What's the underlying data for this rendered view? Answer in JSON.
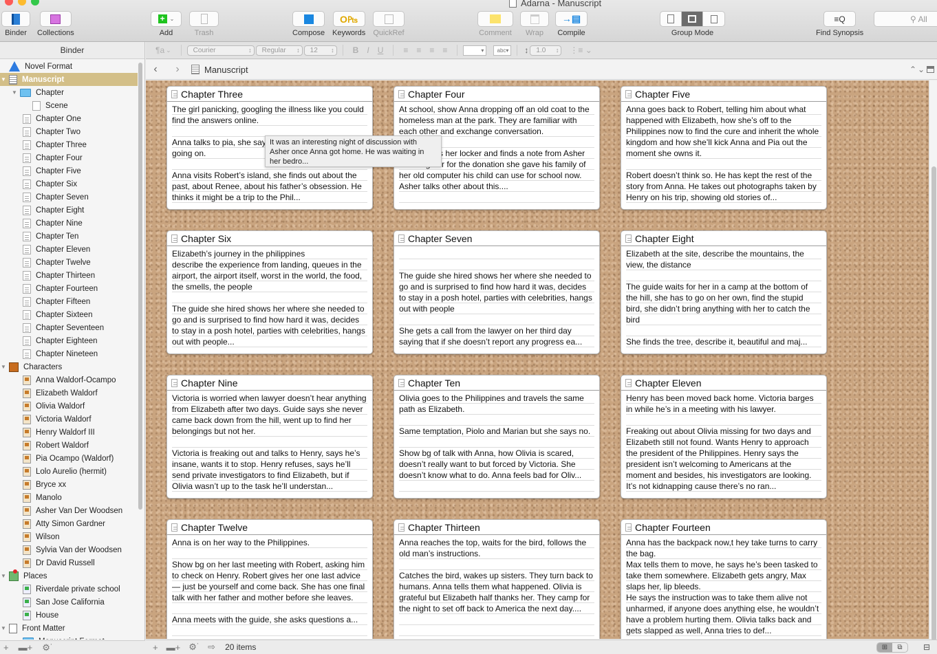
{
  "window": {
    "title": "Adarna - Manuscript",
    "traffic_colors": [
      "#fc5b57",
      "#fdbb2e",
      "#34c84a"
    ]
  },
  "toolbar": {
    "binder": "Binder",
    "collections": "Collections",
    "add": "Add",
    "trash": "Trash",
    "compose": "Compose",
    "keywords": "Keywords",
    "quickref": "QuickRef",
    "comment": "Comment",
    "wrap": "Wrap",
    "compile": "Compile",
    "group_mode": "Group Mode",
    "find_synopsis": "Find Synopsis",
    "search_placeholder": "All"
  },
  "format_bar": {
    "paragraph_style": "¶a",
    "font": "Courier",
    "weight": "Regular",
    "size": "12",
    "bold": "B",
    "italic": "I",
    "underline": "U",
    "highlight": "abc",
    "line_spacing": "1.0"
  },
  "binder": {
    "header": "Binder",
    "items": [
      {
        "label": "Novel Format",
        "icon": "warning-icon",
        "level": 0,
        "disclosure": ""
      },
      {
        "label": "Manuscript",
        "icon": "manuscript-icon",
        "level": 0,
        "disclosure": "open",
        "selected": true
      },
      {
        "label": "Chapter",
        "icon": "folder-icon",
        "level": 1,
        "disclosure": "open"
      },
      {
        "label": "Scene",
        "icon": "blank-doc-icon",
        "level": 2,
        "disclosure": ""
      },
      {
        "label": "Chapter One",
        "icon": "document-icon",
        "level": 1
      },
      {
        "label": "Chapter Two",
        "icon": "document-icon",
        "level": 1
      },
      {
        "label": "Chapter Three",
        "icon": "document-icon",
        "level": 1
      },
      {
        "label": "Chapter Four",
        "icon": "document-icon",
        "level": 1
      },
      {
        "label": "Chapter Five",
        "icon": "document-icon",
        "level": 1
      },
      {
        "label": "Chapter Six",
        "icon": "document-icon",
        "level": 1
      },
      {
        "label": "Chapter Seven",
        "icon": "document-icon",
        "level": 1
      },
      {
        "label": "Chapter Eight",
        "icon": "document-icon",
        "level": 1
      },
      {
        "label": "Chapter Nine",
        "icon": "document-icon",
        "level": 1
      },
      {
        "label": "Chapter Ten",
        "icon": "document-icon",
        "level": 1
      },
      {
        "label": "Chapter Eleven",
        "icon": "document-icon",
        "level": 1
      },
      {
        "label": "Chapter Twelve",
        "icon": "document-icon",
        "level": 1
      },
      {
        "label": "Chapter Thirteen",
        "icon": "document-icon",
        "level": 1
      },
      {
        "label": "Chapter Fourteen",
        "icon": "document-icon",
        "level": 1
      },
      {
        "label": "Chapter Fifteen",
        "icon": "document-icon",
        "level": 1
      },
      {
        "label": "Chapter Sixteen",
        "icon": "document-icon",
        "level": 1
      },
      {
        "label": "Chapter Seventeen",
        "icon": "document-icon",
        "level": 1
      },
      {
        "label": "Chapter Eighteen",
        "icon": "document-icon",
        "level": 1
      },
      {
        "label": "Chapter Nineteen",
        "icon": "document-icon",
        "level": 1
      },
      {
        "label": "Characters",
        "icon": "characters-folder-icon",
        "level": 0,
        "disclosure": "open"
      },
      {
        "label": "Anna Waldorf-Ocampo",
        "icon": "character-sheet-icon",
        "level": 1
      },
      {
        "label": "Elizabeth Waldorf",
        "icon": "character-sheet-icon",
        "level": 1
      },
      {
        "label": "Olivia Waldorf",
        "icon": "character-sheet-icon",
        "level": 1
      },
      {
        "label": "Victoria Waldorf",
        "icon": "character-sheet-icon",
        "level": 1
      },
      {
        "label": "Henry Waldorf III",
        "icon": "character-sheet-icon",
        "level": 1
      },
      {
        "label": "Robert Waldorf",
        "icon": "character-sheet-icon",
        "level": 1
      },
      {
        "label": "Pia Ocampo (Waldorf)",
        "icon": "character-sheet-icon",
        "level": 1
      },
      {
        "label": "Lolo Aurelio (hermit)",
        "icon": "character-sheet-icon",
        "level": 1
      },
      {
        "label": "Bryce xx",
        "icon": "character-sheet-icon",
        "level": 1
      },
      {
        "label": "Manolo",
        "icon": "character-sheet-icon",
        "level": 1
      },
      {
        "label": "Asher Van Der Woodsen",
        "icon": "character-sheet-icon",
        "level": 1
      },
      {
        "label": "Atty Simon Gardner",
        "icon": "character-sheet-icon",
        "level": 1
      },
      {
        "label": "Wilson",
        "icon": "character-sheet-icon",
        "level": 1
      },
      {
        "label": "Sylvia Van der Woodsen",
        "icon": "character-sheet-icon",
        "level": 1
      },
      {
        "label": "Dr David Russell",
        "icon": "character-sheet-icon",
        "level": 1
      },
      {
        "label": "Places",
        "icon": "places-folder-icon",
        "level": 0,
        "disclosure": "open"
      },
      {
        "label": "Riverdale private school",
        "icon": "place-sheet-icon",
        "level": 1
      },
      {
        "label": "San Jose California",
        "icon": "place-sheet-icon",
        "level": 1
      },
      {
        "label": "House",
        "icon": "place-sheet-icon",
        "level": 1
      },
      {
        "label": "Front Matter",
        "icon": "front-matter-icon",
        "level": 0,
        "disclosure": "open"
      },
      {
        "label": "Manuscript Format",
        "icon": "folder-icon",
        "level": 1,
        "disclosure": "closed"
      }
    ]
  },
  "editor": {
    "breadcrumb": "Manuscript",
    "item_count": "20 items",
    "tooltip": "It was an interesting night of discussion with Asher once Anna got home. He was waiting in her bedro...",
    "cards": [
      {
        "title": "Chapter Three",
        "synopsis": "The girl panicking, googling the illness like you could find the answers online.\n\nAnna talks to pia, she says she might know what’s going on.\n\nAnna visits Robert’s island, she finds out about the past, about Renee, about his father’s obsession. He thinks it might be a trip to the Phil..."
      },
      {
        "title": "Chapter Four",
        "synopsis": "At school, show Anna dropping off an old coat to the homeless man at the park. They are familiar with each other and exchange conversation.\n\nAnna opens her locker and finds a note from Asher thanking her for the donation she gave his family of her old computer his child can use for school now. Asher talks other about this...."
      },
      {
        "title": "Chapter Five",
        "synopsis": "Anna goes back to Robert, telling him about what happened with Elizabeth, how she’s off to the Philippines now to find the cure and inherit the whole kingdom and how she’ll kick Anna and Pia out the moment she owns it.\n\nRobert doesn’t think so. He has kept the rest of the story from Anna. He takes out photographs taken by Henry on his trip, showing old stories of..."
      },
      {
        "title": "Chapter Six",
        "synopsis": "Elizabeth’s journey in the philippines\ndescribe the experience from landing, queues in the airport, the airport itself, worst in the world, the food, the smells, the people\n\nThe guide she hired shows her where she needed to go and is surprised to find how hard it was, decides to stay in a posh hotel, parties with celebrities, hangs out with people..."
      },
      {
        "title": "Chapter Seven",
        "synopsis": "\n\nThe guide she hired shows her where she needed to go and is surprised to find how hard it was, decides to stay in a posh hotel, parties with celebrities, hangs out with people\n\nShe gets a call from the lawyer on her third day saying that if she doesn’t report any progress ea..."
      },
      {
        "title": "Chapter Eight",
        "synopsis": "Elizabeth at the site, describe the mountains, the view, the distance\n\nThe guide waits for her in a camp at the bottom of the hill, she has to go on her own, find the stupid bird, she didn’t bring anything with her to catch the bird\n\nShe finds the tree, describe it, beautiful and maj..."
      },
      {
        "title": "Chapter Nine",
        "synopsis": "Victoria is worried when lawyer doesn’t hear anything from Elizabeth after two days. Guide says she never came back down from the hill, went up to find her belongings but not her.\n\nVictoria is freaking out and talks to Henry, says he’s insane, wants it to stop. Henry refuses, says he’ll send private investigators to find Elizabeth, but if Olivia wasn’t up to the task he’ll understan..."
      },
      {
        "title": "Chapter Ten",
        "synopsis": "Olivia goes to the Philippines and travels the same path as Elizabeth.\n\nSame temptation, Piolo and Marian but she says no.\n\nShow bg of talk with Anna, how Olivia is scared, doesn’t really want to but forced by Victoria. She doesn’t know what to do. Anna feels bad for Oliv..."
      },
      {
        "title": "Chapter Eleven",
        "synopsis": "Henry has been moved back home. Victoria barges in while he’s in a meeting with his lawyer.\n\nFreaking out about Olivia missing for two days and Elizabeth still not found. Wants Henry to approach the president of the Philippines. Henry says the president isn’t welcoming to Americans at the moment and besides, his investigators are looking. It’s not kidnapping cause there’s no ran..."
      },
      {
        "title": "Chapter Twelve",
        "synopsis": "Anna is on her way to the Philippines.\n\nShow bg on her last meeting with Robert, asking him to check on Henry. Robert gives her one last advice — just be yourself and come back. She has one final talk with her father and mother before she leaves.\n\nAnna meets with the guide, she asks questions a..."
      },
      {
        "title": "Chapter Thirteen",
        "synopsis": "Anna reaches the top, waits for the bird, follows the old man’s instructions.\n\nCatches the bird, wakes up sisters. They turn back to humans. Anna tells them what happened. Olivia is grateful but Elizabeth half thanks her. They camp for the night to set off back to America the next day...."
      },
      {
        "title": "Chapter Fourteen",
        "synopsis": "Anna has the backpack now,t hey take turns to carry the bag.\nMax tells them to move, he says he’s been tasked to take them somewhere. Elizabeth gets angry, Max slaps her, lip bleeds.\nHe says the instruction was to take them alive not unharmed, if anyone does anything else, he wouldn’t have a problem hurting them. Olivia talks back and gets slapped as well, Anna tries to def..."
      }
    ]
  }
}
